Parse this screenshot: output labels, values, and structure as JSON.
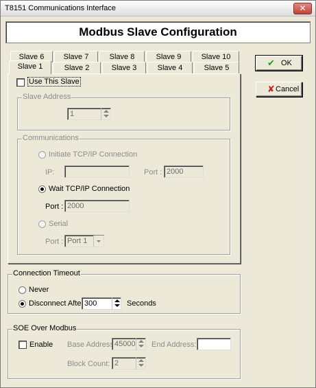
{
  "window": {
    "title": "T8151 Communications Interface",
    "close_glyph": "✕"
  },
  "header": {
    "title": "Modbus Slave Configuration"
  },
  "tabs": {
    "row_back": [
      "Slave 6",
      "Slave 7",
      "Slave 8",
      "Slave 9",
      "Slave 10"
    ],
    "row_front": [
      "Slave 1",
      "Slave 2",
      "Slave 3",
      "Slave 4",
      "Slave 5"
    ],
    "active": "Slave 1"
  },
  "slave": {
    "use_label": "Use This Slave",
    "use_checked": false,
    "address_group": "Slave Address",
    "address_value": "1"
  },
  "comms": {
    "group": "Communications",
    "initiate_label": "Initiate TCP/IP Connection",
    "ip_label": "IP:",
    "ip_value": "",
    "initiate_port_label": "Port :",
    "initiate_port_value": "2000",
    "wait_label": "Wait TCP/IP Connection",
    "wait_port_label": "Port :",
    "wait_port_value": "2000",
    "serial_label": "Serial",
    "serial_port_label": "Port :",
    "serial_port_value": "Port 1",
    "selected": "wait"
  },
  "timeout": {
    "group": "Connection Timeout",
    "never_label": "Never",
    "disconnect_label": "Disconnect After",
    "disconnect_value": "300",
    "seconds_label": "Seconds",
    "selected": "disconnect"
  },
  "soe": {
    "group": "SOE Over Modbus",
    "enable_label": "Enable",
    "enable_checked": false,
    "base_label": "Base Address:",
    "base_value": "45000",
    "end_label": "End Address:",
    "end_value": "",
    "block_label": "Block Count:",
    "block_value": "2"
  },
  "buttons": {
    "ok_label": "OK",
    "ok_icon": "check-icon",
    "cancel_label": "Cancel",
    "cancel_icon": "x-icon"
  },
  "colors": {
    "ok_icon": "#1a9a1a",
    "cancel_icon": "#c81e1e",
    "disabled_text": "#8c8c8c"
  }
}
